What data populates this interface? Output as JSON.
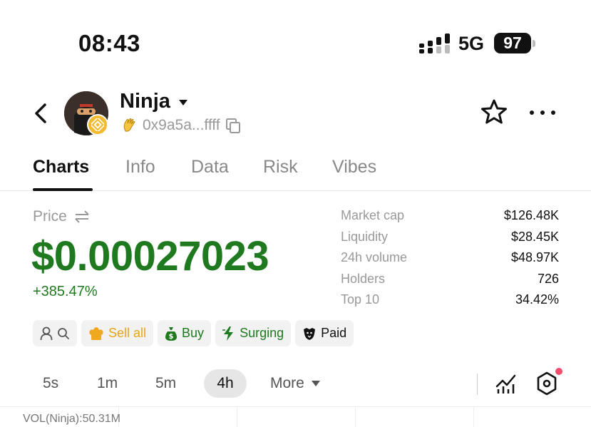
{
  "status_bar": {
    "time": "08:43",
    "network": "5G",
    "battery": "97"
  },
  "header": {
    "token_name": "Ninja",
    "address": "0x9a5a...ffff"
  },
  "tabs": [
    {
      "label": "Charts",
      "active": true
    },
    {
      "label": "Info",
      "active": false
    },
    {
      "label": "Data",
      "active": false
    },
    {
      "label": "Risk",
      "active": false
    },
    {
      "label": "Vibes",
      "active": false
    }
  ],
  "price": {
    "label": "Price",
    "value": "$0.00027023",
    "change": "+385.47%"
  },
  "stats": [
    {
      "label": "Market cap",
      "value": "$126.48K"
    },
    {
      "label": "Liquidity",
      "value": "$28.45K"
    },
    {
      "label": "24h volume",
      "value": "$48.97K"
    },
    {
      "label": "Holders",
      "value": "726"
    },
    {
      "label": "Top 10",
      "value": "34.42%"
    }
  ],
  "chips": {
    "sell_all": "Sell all",
    "buy": "Buy",
    "surging": "Surging",
    "paid": "Paid"
  },
  "timeframes": {
    "items": [
      "5s",
      "1m",
      "5m",
      "4h"
    ],
    "active": "4h",
    "more": "More"
  },
  "chart": {
    "volume_label": "VOL(Ninja):50.31M"
  },
  "colors": {
    "positive": "#1f7a1f",
    "sell": "#e8a417",
    "chain_badge": "#f3ba2f",
    "notification": "#ef4d6b"
  }
}
